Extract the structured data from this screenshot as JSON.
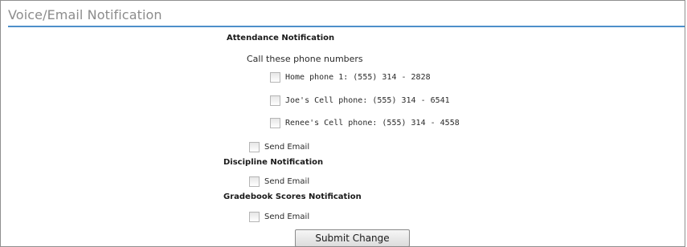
{
  "panel": {
    "title": "Voice/Email Notification"
  },
  "attendance": {
    "heading": "Attendance Notification",
    "call_label": "Call these phone numbers",
    "phones": [
      {
        "label": "Home phone 1:  (555) 314 - 2828"
      },
      {
        "label": "Joe's Cell phone: (555) 314 - 6541"
      },
      {
        "label": "Renee's Cell phone: (555) 314 - 4558"
      }
    ],
    "email_label": "Send Email"
  },
  "discipline": {
    "heading": "Discipline Notification",
    "email_label": "Send Email"
  },
  "gradebook": {
    "heading": "Gradebook Scores Notification",
    "email_label": "Send Email"
  },
  "submit": {
    "label": "Submit Change"
  },
  "colors": {
    "accent_rule": "#4d8fc9",
    "title_text": "#8c8c8c"
  }
}
